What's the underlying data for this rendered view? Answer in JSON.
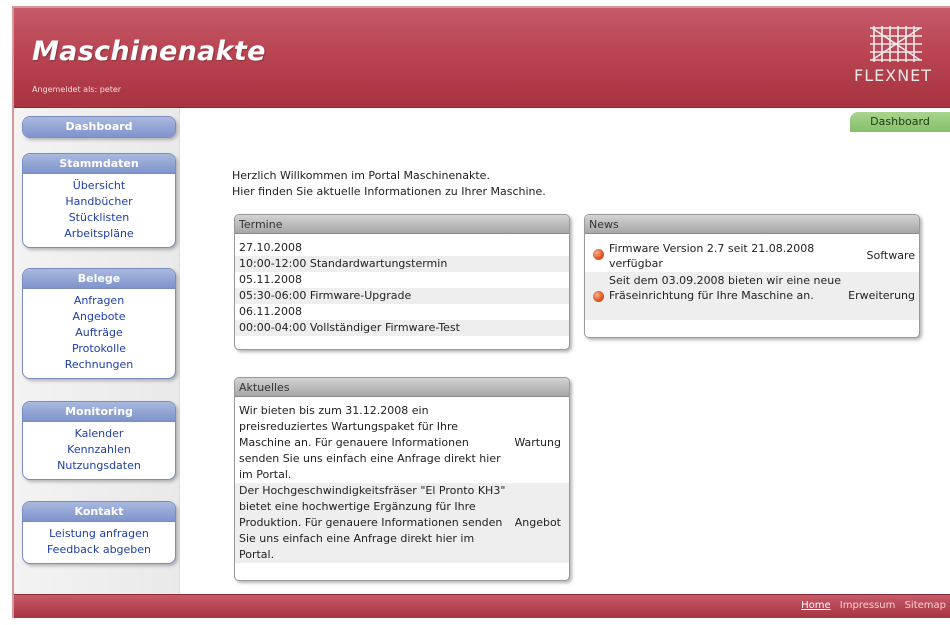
{
  "header": {
    "title": "Maschinenakte",
    "login_info": "Angemeldet als: peter",
    "logo_text": "FLEXNET"
  },
  "breadcrumb_tab": "Dashboard",
  "sidebar": {
    "dashboard": "Dashboard",
    "stammdaten": {
      "title": "Stammdaten",
      "items": [
        "Übersicht",
        "Handbücher",
        "Stücklisten",
        "Arbeitspläne"
      ]
    },
    "belege": {
      "title": "Belege",
      "items": [
        "Anfragen",
        "Angebote",
        "Aufträge",
        "Protokolle",
        "Rechnungen"
      ]
    },
    "monitoring": {
      "title": "Monitoring",
      "items": [
        "Kalender",
        "Kennzahlen",
        "Nutzungsdaten"
      ]
    },
    "kontakt": {
      "title": "Kontakt",
      "items": [
        "Leistung anfragen",
        "Feedback abgeben"
      ]
    }
  },
  "welcome": {
    "line1": "Herzlich Willkommen im Portal Maschinenakte.",
    "line2": "Hier finden Sie aktuelle Informationen zu Ihrer Maschine."
  },
  "termine": {
    "title": "Termine",
    "rows": [
      "27.10.2008",
      "10:00-12:00 Standardwartungstermin",
      "05.11.2008",
      "05:30-06:00 Firmware-Upgrade",
      "06.11.2008",
      "00:00-04:00 Vollständiger Firmware-Test"
    ]
  },
  "news": {
    "title": "News",
    "items": [
      {
        "text": "Firmware Version 2.7 seit 21.08.2008 verfügbar",
        "category": "Software"
      },
      {
        "text": "Seit dem 03.09.2008 bieten wir eine neue Fräseinrichtung für Ihre Maschine an.",
        "category": "Erweiterung"
      }
    ]
  },
  "aktuelles": {
    "title": "Aktuelles",
    "items": [
      {
        "text": "Wir bieten bis zum 31.12.2008 ein preisreduziertes Wartungspaket für Ihre Maschine an. Für genauere Informationen senden Sie uns einfach eine Anfrage direkt hier im Portal.",
        "category": "Wartung"
      },
      {
        "text": "Der Hochgeschwindigkeitsfräser \"El Pronto KH3\" bietet eine hochwertige Ergänzung für Ihre Produktion. Für genauere Informationen senden Sie uns einfach eine Anfrage direkt hier im Portal.",
        "category": "Angebot"
      }
    ]
  },
  "footer": {
    "links": [
      "Home",
      "Impressum",
      "Sitemap"
    ]
  },
  "colors": {
    "header": "#b94452",
    "sidebar_head": "#8fa2d3",
    "link": "#1f3fa6",
    "tab": "#94c97a"
  }
}
